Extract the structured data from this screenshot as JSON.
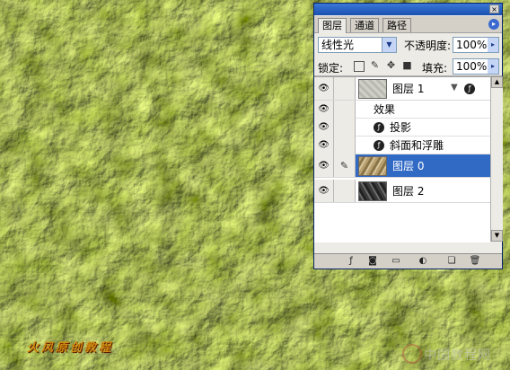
{
  "panel": {
    "tabs": [
      "图层",
      "通道",
      "路径"
    ],
    "blend_mode": "线性光",
    "opacity_label": "不透明度:",
    "opacity_value": "100%",
    "lock_label": "锁定:",
    "fill_label": "填充:",
    "fill_value": "100%",
    "layers": [
      {
        "name": "图层 1",
        "selected": false
      },
      {
        "name": "图层 0",
        "selected": true
      },
      {
        "name": "图层 2",
        "selected": false
      }
    ],
    "effects_label": "效果",
    "effects": [
      "投影",
      "斜面和浮雕"
    ]
  },
  "canvas": {
    "watermark": "火风原创教程",
    "site_name": "中国教程网"
  },
  "icons": {
    "visibility": "eye-icon",
    "brush": "brush-icon",
    "fx": "fx-icon",
    "lock": "lock-icon"
  },
  "colors": {
    "panel_bg": "#ecebe5",
    "selection": "#316ac5",
    "titlebar": "#1a50b0"
  }
}
